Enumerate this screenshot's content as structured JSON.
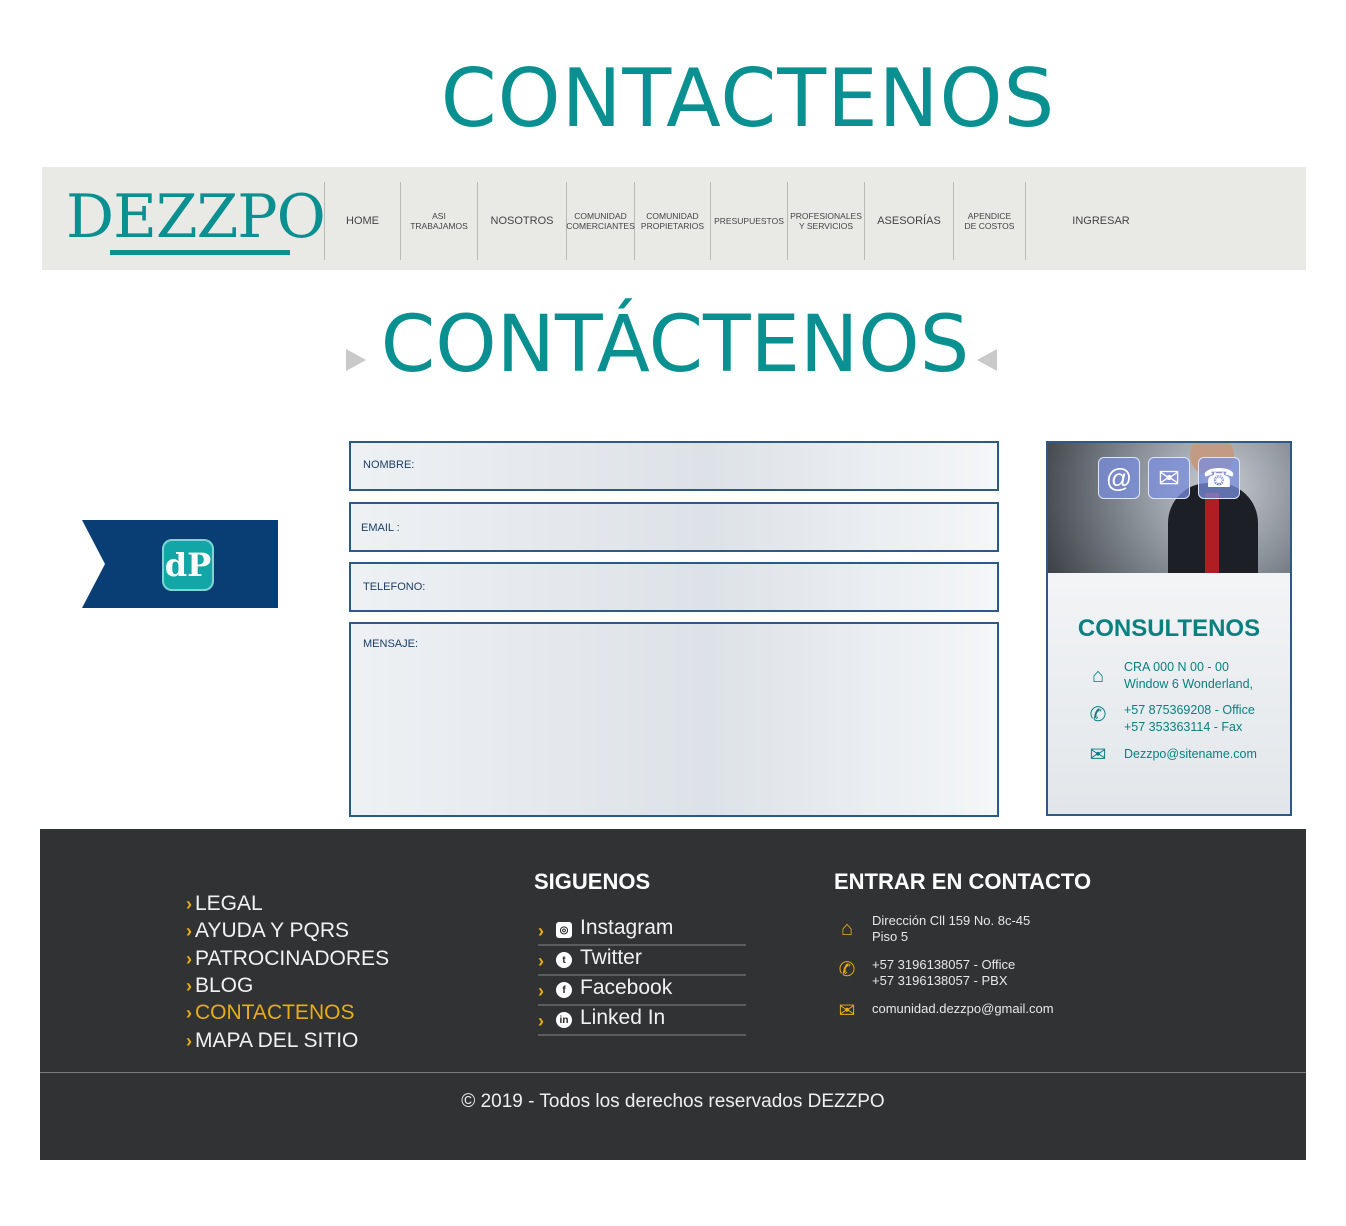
{
  "page_heading": "CONTACTENOS",
  "brand": {
    "logo_text": "DEZZPO"
  },
  "nav": [
    {
      "label": "HOME",
      "size": "big"
    },
    {
      "label": "ASI\nTRABAJAMOS",
      "size": "small"
    },
    {
      "label": "NOSOTROS",
      "size": "big"
    },
    {
      "label": "COMUNIDAD\nCOMERCIANTES",
      "size": "small"
    },
    {
      "label": "COMUNIDAD\nPROPIETARIOS",
      "size": "small"
    },
    {
      "label": "PRESUPUESTOS",
      "size": "small"
    },
    {
      "label": "PROFESIONALES\nY SERVICIOS",
      "size": "small"
    },
    {
      "label": "ASESORÍAS",
      "size": "big"
    },
    {
      "label": "APENDICE\nDE COSTOS",
      "size": "small"
    },
    {
      "label": "INGRESAR",
      "size": "big"
    }
  ],
  "section_title": "CONTÁCTENOS",
  "form": {
    "nombre_label": "NOMBRE:",
    "email_label": "EMAIL :",
    "telefono_label": "TELEFONO:",
    "mensaje_label": "MENSAJE:"
  },
  "card": {
    "title": "CONSULTENOS",
    "address_line1": "CRA 000  N 00 - 00",
    "address_line2": "Window 6 Wonderland,",
    "phone_line1": "+57 875369208 - Office",
    "phone_line2": "+57 353363114 - Fax",
    "email": "Dezzpo@sitename.com",
    "icons": [
      "at-icon",
      "envelope-icon",
      "telephone-icon"
    ]
  },
  "footer": {
    "links": [
      {
        "label": "LEGAL",
        "active": false
      },
      {
        "label": "AYUDA Y PQRS",
        "active": false
      },
      {
        "label": "PATROCINADORES",
        "active": false
      },
      {
        "label": "BLOG",
        "active": false
      },
      {
        "label": "CONTACTENOS",
        "active": true
      },
      {
        "label": "MAPA DEL SITIO",
        "active": false
      }
    ],
    "social_heading": "SIGUENOS",
    "social": [
      {
        "label": "Instagram",
        "icon": "instagram-icon"
      },
      {
        "label": "Twitter",
        "icon": "twitter-icon"
      },
      {
        "label": "Facebook",
        "icon": "facebook-icon"
      },
      {
        "label": "Linked In",
        "icon": "linkedin-icon"
      }
    ],
    "contact_heading": "ENTRAR EN CONTACTO",
    "contact_address_line1": "Dirección  Cll 159 No. 8c-45",
    "contact_address_line2": "Piso 5",
    "contact_phone_line1": "+57 3196138057 - Office",
    "contact_phone_line2": "+57 3196138057 - PBX",
    "contact_email": "comunidad.dezzpo@gmail.com",
    "copyright": "© 2019 - Todos los derechos reservados DEZZPO"
  },
  "colors": {
    "teal": "#0a9090",
    "navy": "#083e74",
    "footer_bg": "#313233",
    "accent_yellow": "#e7ad15"
  }
}
